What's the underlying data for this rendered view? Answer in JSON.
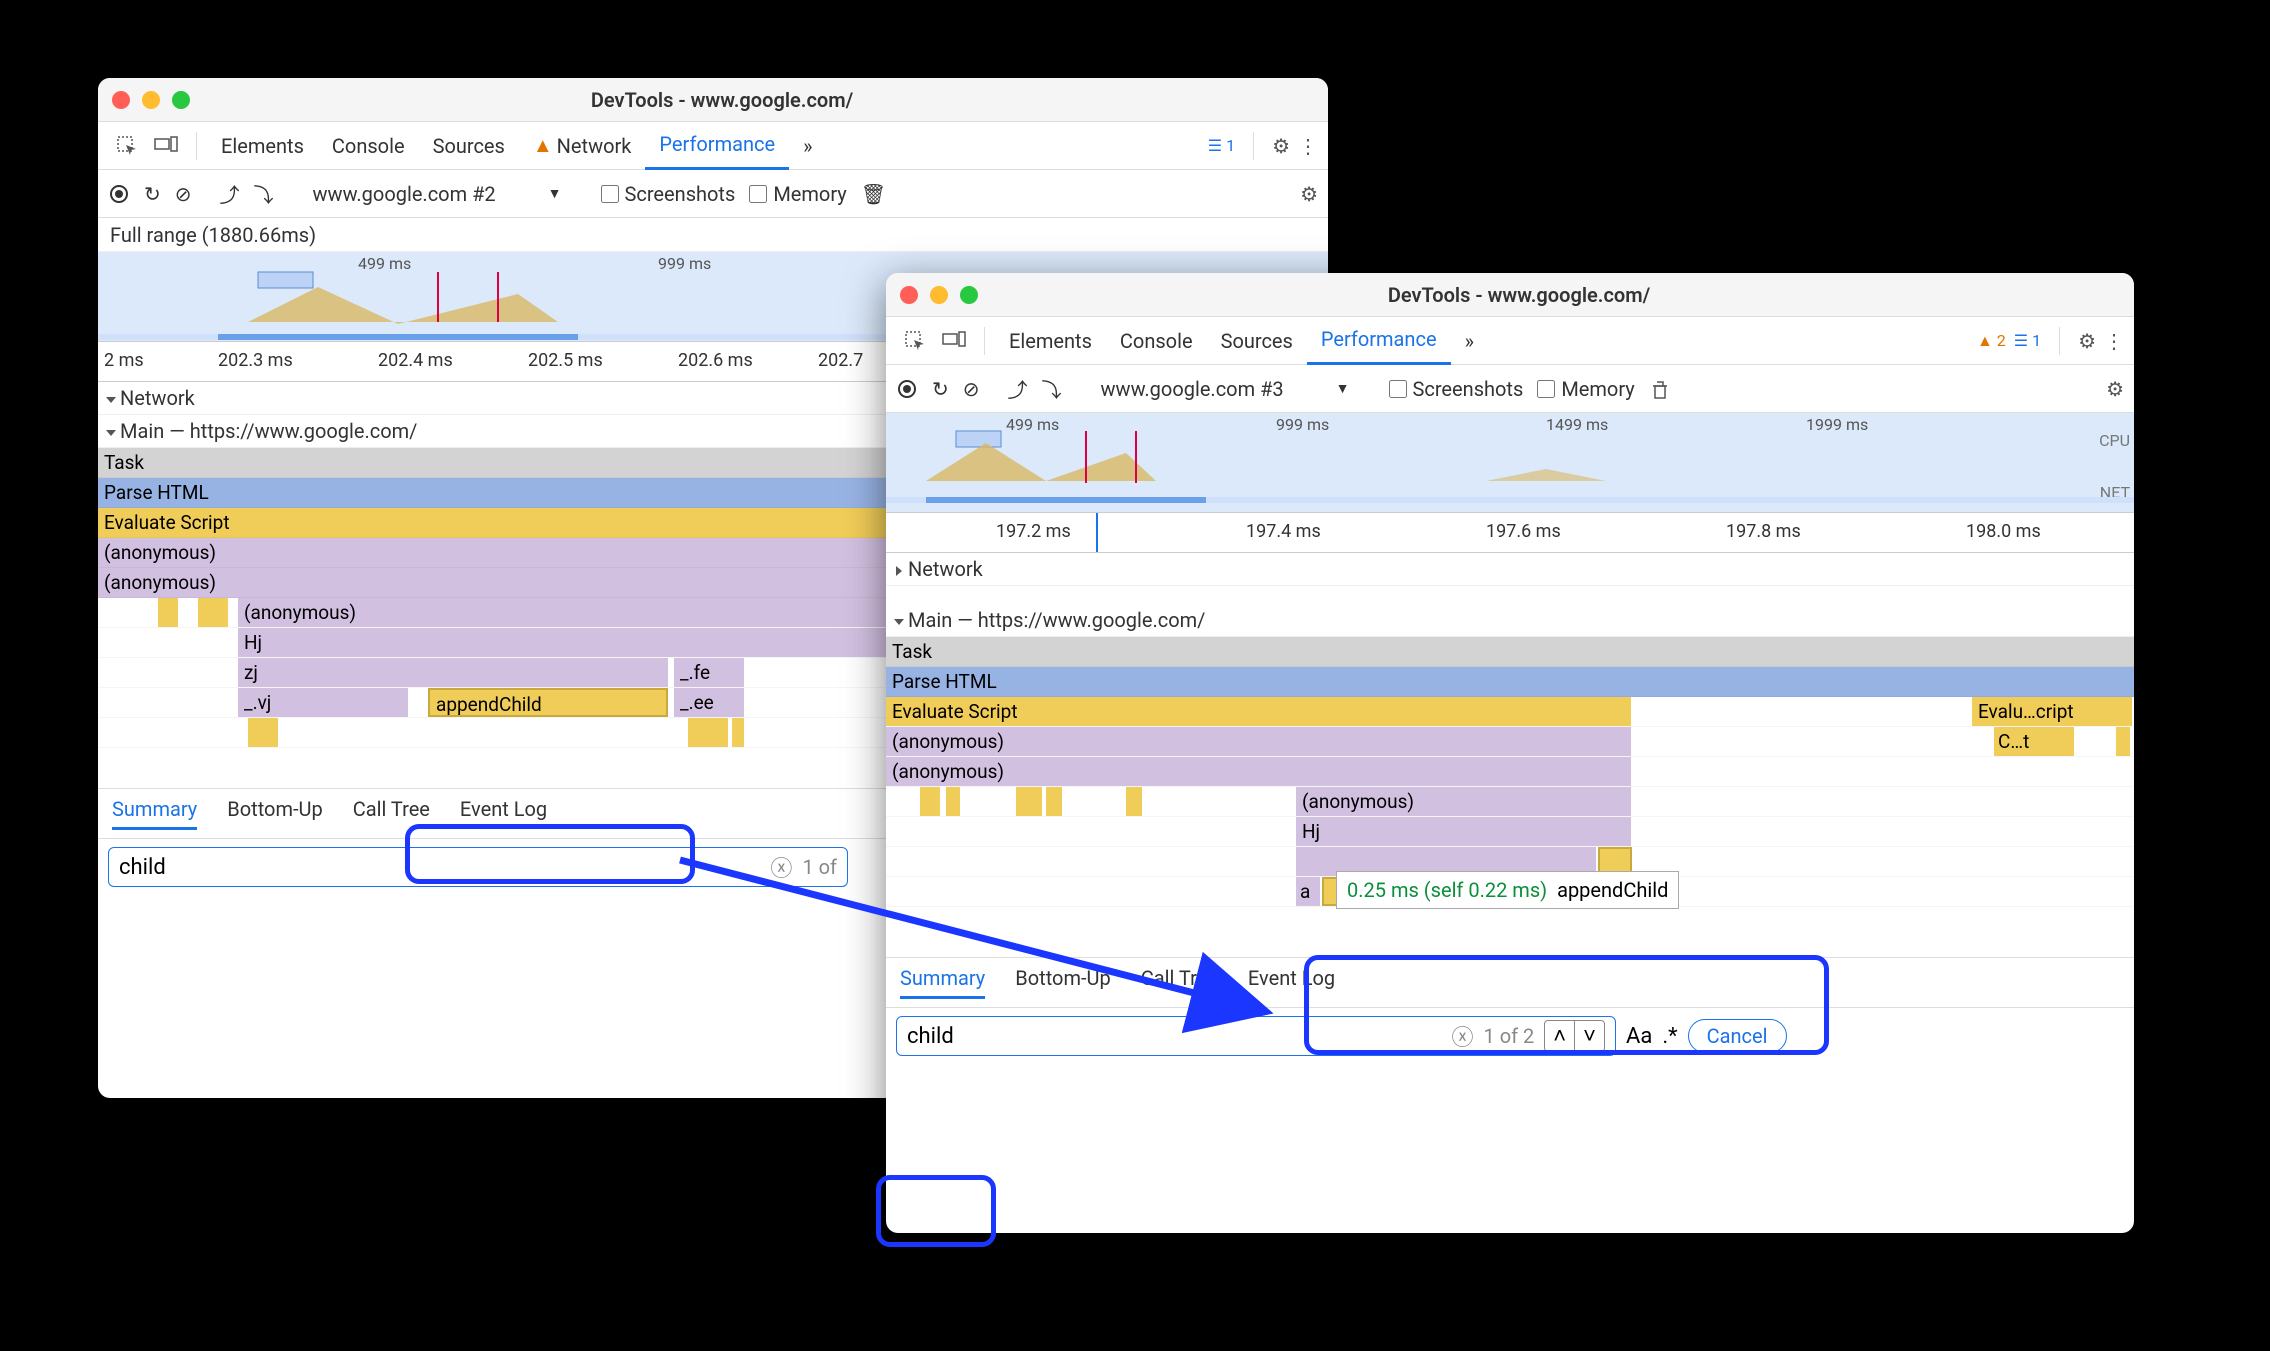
{
  "windows": {
    "left": {
      "title": "DevTools - www.google.com/",
      "tabs": [
        "Elements",
        "Console",
        "Sources",
        "Network",
        "Performance"
      ],
      "tabs_active": 4,
      "more_glyph": "»",
      "msg_count": "1",
      "record_title": "Record",
      "selector": "www.google.com #2",
      "screenshots_label": "Screenshots",
      "memory_label": "Memory",
      "range_label": "Full range (1880.66ms)",
      "overview_ticks": [
        "499 ms",
        "999 ms"
      ],
      "ruler_ticks": [
        "2 ms",
        "202.3 ms",
        "202.4 ms",
        "202.5 ms",
        "202.6 ms",
        "202.7"
      ],
      "tracks": {
        "network": "Network",
        "main": "Main — https://www.google.com/"
      },
      "flame": {
        "task": "Task",
        "parse": "Parse HTML",
        "eval": "Evaluate Script",
        "anon1": "(anonymous)",
        "anon2": "(anonymous)",
        "anon3": "(anonymous)",
        "hj": "Hj",
        "zj": "zj",
        "vj": "_.vj",
        "appendChild": "appendChild",
        "fe": "_.fe",
        "ee": "_.ee"
      },
      "panel_tabs": [
        "Summary",
        "Bottom-Up",
        "Call Tree",
        "Event Log"
      ],
      "search_value": "child",
      "search_count": "1 of"
    },
    "right": {
      "title": "DevTools - www.google.com/",
      "tabs": [
        "Elements",
        "Console",
        "Sources",
        "Performance"
      ],
      "tabs_active": 3,
      "more_glyph": "»",
      "warn_count": "2",
      "msg_count": "1",
      "selector": "www.google.com #3",
      "screenshots_label": "Screenshots",
      "memory_label": "Memory",
      "overview_ticks": [
        "499 ms",
        "999 ms",
        "1499 ms",
        "1999 ms"
      ],
      "cpu_label": "CPU",
      "net_label": "NET",
      "ruler_ticks": [
        "197.2 ms",
        "197.4 ms",
        "197.6 ms",
        "197.8 ms",
        "198.0 ms"
      ],
      "tracks": {
        "network": "Network",
        "main": "Main — https://www.google.com/"
      },
      "flame": {
        "task": "Task",
        "parse": "Parse HTML",
        "eval": "Evaluate Script",
        "eval2": "Evalu…cript",
        "ct": "C…t",
        "anon1": "(anonymous)",
        "anon2": "(anonymous)",
        "anon3": "(anonymous)",
        "hj": "Hj",
        "a": "a"
      },
      "tooltip": {
        "time_total": "0.25 ms",
        "time_self": "(self 0.22 ms)",
        "name": "appendChild"
      },
      "panel_tabs": [
        "Summary",
        "Bottom-Up",
        "Call Tree",
        "Event Log"
      ],
      "search_value": "child",
      "search_count": "1 of 2",
      "match_case": "Aa",
      "regex": ".*",
      "cancel": "Cancel"
    }
  }
}
